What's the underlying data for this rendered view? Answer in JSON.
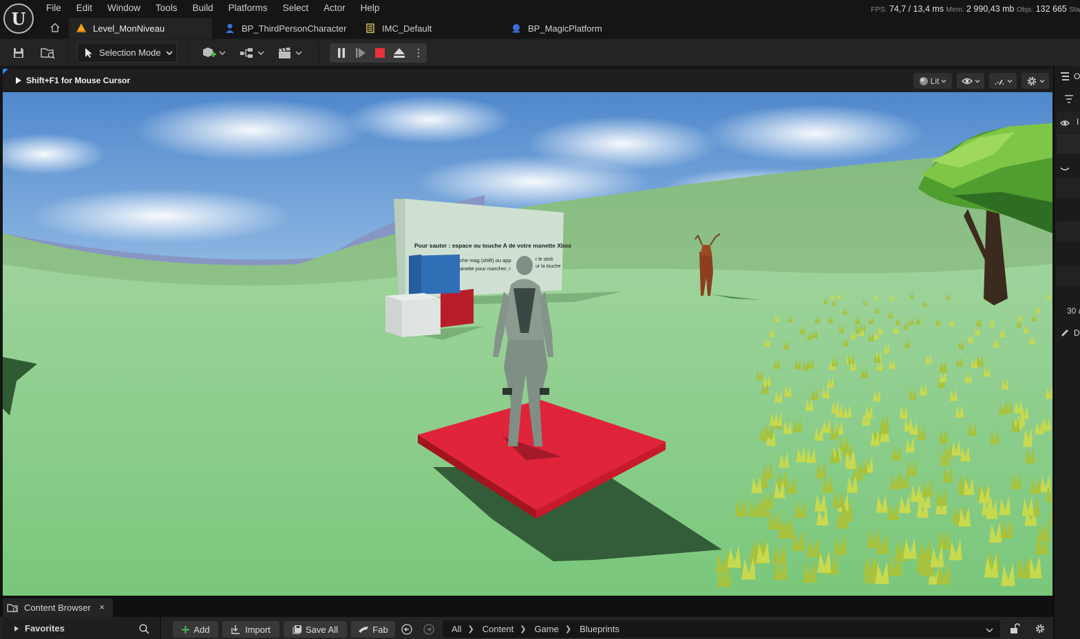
{
  "menu": [
    "File",
    "Edit",
    "Window",
    "Tools",
    "Build",
    "Platforms",
    "Select",
    "Actor",
    "Help"
  ],
  "stats": {
    "fps_label": "FPS:",
    "fps": "74,7",
    "ms": "/ 13,4 ms",
    "mem_label": "Mem:",
    "mem": "2 990,43 mb",
    "objs_label": "Objs:",
    "objs": "132 665",
    "trailing": "Sta"
  },
  "tabs": [
    {
      "label": "Level_MonNiveau",
      "icon": "level-icon",
      "active": true
    },
    {
      "label": "BP_ThirdPersonCharacter",
      "icon": "blueprint-character-icon",
      "active": false
    },
    {
      "label": "IMC_Default",
      "icon": "input-mapping-icon",
      "active": false
    },
    {
      "label": "BP_MagicPlatform",
      "icon": "blueprint-actor-icon",
      "active": false
    }
  ],
  "toolbar": {
    "selection_mode": "Selection Mode"
  },
  "viewport": {
    "hint": "Shift+F1 for Mouse Cursor",
    "view_mode": "Lit",
    "scene": {
      "sign_text_1": "Pour sauter : espace ou touche A de votre manette Xbox",
      "sign_text_2": "che mag (shift) ou app",
      "sign_text_3": "r le stick",
      "sign_text_4": "anette pour marcher, r",
      "sign_text_5": "ur la touche"
    }
  },
  "right_panel": {
    "row_value": "30 a",
    "text_a": "O",
    "text_b": "I",
    "text_c": "D"
  },
  "content_browser": {
    "tab_label": "Content Browser",
    "close": "×",
    "favorites": "Favorites",
    "add": "Add",
    "import": "Import",
    "save_all": "Save All",
    "fab": "Fab",
    "path": [
      "All",
      "Content",
      "Game",
      "Blueprints"
    ]
  },
  "colors": {
    "accent_blue": "#2a8cff",
    "stop_red": "#e8323a",
    "platform_red": "#e0243a",
    "grass": "#7fcb82",
    "tab_level_orange": "#f3a51c"
  }
}
